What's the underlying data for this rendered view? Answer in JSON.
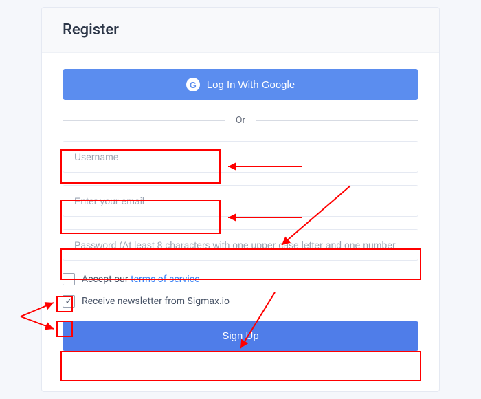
{
  "header": {
    "title": "Register"
  },
  "google": {
    "label": "Log In With Google",
    "icon_letter": "G"
  },
  "divider": {
    "label": "Or"
  },
  "fields": {
    "username": {
      "placeholder": "Username",
      "value": ""
    },
    "email": {
      "placeholder": "Enter your email",
      "value": ""
    },
    "password": {
      "placeholder": "Password (At least 8 characters with one upper case letter and one number",
      "value": ""
    }
  },
  "terms": {
    "prefix": "Accept our ",
    "link_text": "terms of service",
    "checked": false
  },
  "newsletter": {
    "label": "Receive newsletter from Sigmax.io",
    "checked": true
  },
  "submit": {
    "label": "Sign Up"
  },
  "colors": {
    "primary": "#4f7de9",
    "google": "#5b8def",
    "annotation": "#ff0000",
    "link": "#3b82f6"
  }
}
